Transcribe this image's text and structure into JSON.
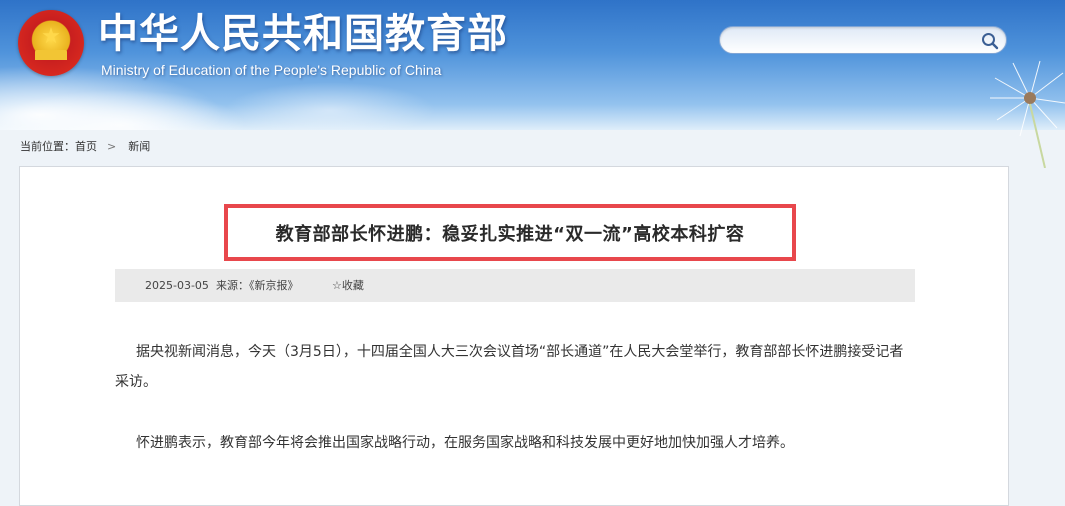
{
  "site": {
    "title_cn": "中华人民共和国教育部",
    "title_en": "Ministry of Education of the People's Republic of China"
  },
  "search": {
    "value": "",
    "icon": "search-icon"
  },
  "breadcrumb": {
    "label": "当前位置：",
    "home": "首页",
    "separator": ">",
    "current": "新闻"
  },
  "article": {
    "headline": "教育部部长怀进鹏：稳妥扎实推进“双一流”高校本科扩容",
    "date": "2025-03-05",
    "source": "来源：《新京报》",
    "favorite": "收藏",
    "paragraphs": [
      "据央视新闻消息，今天（3月5日），十四届全国人大三次会议首场“部长通道”在人民大会堂举行，教育部部长怀进鹏接受记者采访。",
      "怀进鹏表示，教育部今年将会推出国家战略行动，在服务国家战略和科技发展中更好地加快加强人才培养。"
    ]
  },
  "colors": {
    "header_blue": "#4f93db",
    "highlight_border": "#e8474c",
    "meta_bg": "#eaeaea"
  }
}
